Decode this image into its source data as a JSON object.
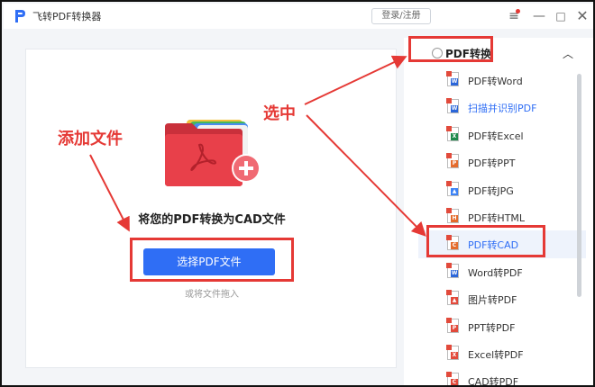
{
  "window": {
    "title": "飞转PDF转换器",
    "login_label": "登录/注册",
    "menu_icon": "≡",
    "minimize_icon": "—",
    "maximize_icon": "□",
    "close_icon": "✕"
  },
  "drop_area": {
    "title": "将您的PDF转换为CAD文件",
    "select_button": "选择PDF文件",
    "drag_hint": "或将文件拖入"
  },
  "sidebar": {
    "header": "PDF转换",
    "collapse_icon": "︿",
    "items": [
      {
        "label": "PDF转Word",
        "badge": "W",
        "color": "#2b66d9"
      },
      {
        "label": "扫描并识别PDF",
        "badge": "W",
        "color": "#2b66d9"
      },
      {
        "label": "PDF转Excel",
        "badge": "X",
        "color": "#1f8a4c"
      },
      {
        "label": "PDF转PPT",
        "badge": "P",
        "color": "#e46b2c"
      },
      {
        "label": "PDF转JPG",
        "badge": "▲",
        "color": "#3b82f6"
      },
      {
        "label": "PDF转HTML",
        "badge": "H",
        "color": "#e46b2c"
      },
      {
        "label": "PDF转CAD",
        "badge": "C",
        "color": "#e46b2c"
      },
      {
        "label": "Word转PDF",
        "badge": "W",
        "color": "#2b66d9"
      },
      {
        "label": "图片转PDF",
        "badge": "▲",
        "color": "#e24a3b"
      },
      {
        "label": "PPT转PDF",
        "badge": "P",
        "color": "#e24a3b"
      },
      {
        "label": "Excel转PDF",
        "badge": "X",
        "color": "#e24a3b"
      },
      {
        "label": "CAD转PDF",
        "badge": "C",
        "color": "#e24a3b"
      }
    ]
  },
  "annotations": {
    "add_file": "添加文件",
    "select": "选中"
  },
  "colors": {
    "accent": "#2f6ef5",
    "annotation": "#e53935",
    "folder": "#e8404a"
  }
}
